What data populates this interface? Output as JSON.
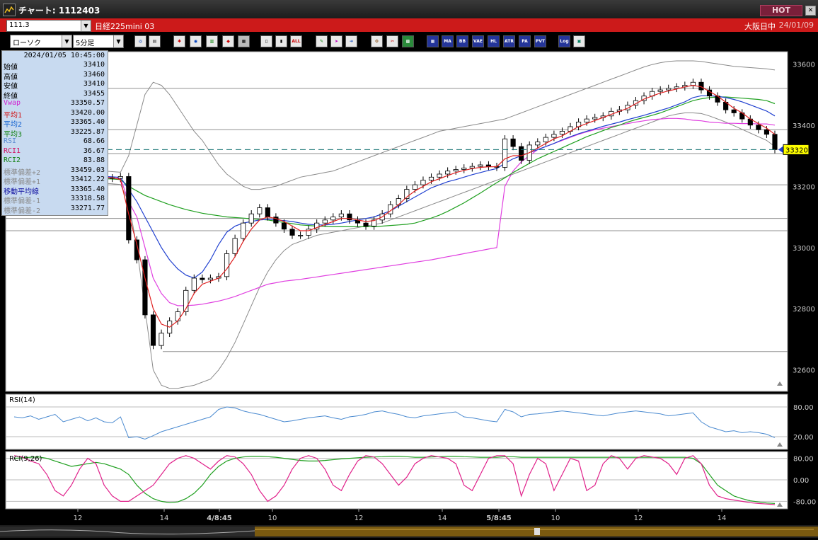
{
  "window": {
    "title": "チャート: 1112403",
    "hot_label": "HOT"
  },
  "header": {
    "code": "111.3",
    "instrument": "日経225mini 03",
    "market": "大阪日中",
    "date": "24/01/09"
  },
  "toolbar": {
    "chart_type": "ローソク",
    "timeframe": "5分足",
    "buttons": [
      "MA",
      "BB",
      "VAE",
      "HL",
      "ATR",
      "PA",
      "PVT",
      "Log"
    ]
  },
  "info_panel": {
    "datetime": "2024/01/05  10:45:00",
    "rows": [
      {
        "label": "始値",
        "value": "33410",
        "color": "#000000"
      },
      {
        "label": "高値",
        "value": "33460",
        "color": "#000000"
      },
      {
        "label": "安値",
        "value": "33410",
        "color": "#000000"
      },
      {
        "label": "終値",
        "value": "33455",
        "color": "#000000"
      },
      {
        "label": "Vwap",
        "value": "33350.57",
        "color": "#d020d0"
      },
      {
        "label": "平均1",
        "value": "33420.00",
        "color": "#d01010"
      },
      {
        "label": "平均2",
        "value": "33365.40",
        "color": "#1060d0"
      },
      {
        "label": "平均3",
        "value": "33225.87",
        "color": "#108010"
      },
      {
        "label": "RSI",
        "value": "68.66",
        "color": "#5a8ad0"
      },
      {
        "label": "RCI1",
        "value": "36.67",
        "color": "#d01060"
      },
      {
        "label": "RCI2",
        "value": "83.88",
        "color": "#108010"
      },
      {
        "label": "標準偏差+2",
        "value": "33459.03",
        "color": "#8a8a8a"
      },
      {
        "label": "標準偏差+1",
        "value": "33412.22",
        "color": "#8a8a8a"
      },
      {
        "label": "移動平均線",
        "value": "33365.40",
        "color": "#1010a0"
      },
      {
        "label": "標準偏差-1",
        "value": "33318.58",
        "color": "#8a8a8a"
      },
      {
        "label": "標準偏差-2",
        "value": "33271.77",
        "color": "#8a8a8a"
      }
    ]
  },
  "price_badge": "33320",
  "colors": {
    "ma_short": "#e02020",
    "ma_mid": "#2040d0",
    "ma_long": "#20a020",
    "vwap": "#e040e0",
    "bands": "#8a8a8a",
    "rsi": "#4a8ad0",
    "rci_short": "#e0208a",
    "rci_long": "#20a020"
  },
  "chart_data": {
    "type": "candlestick",
    "y_range": [
      32530,
      33640
    ],
    "y_ticks": [
      "33600",
      "33400",
      "33200",
      "33000",
      "32800",
      "32600"
    ],
    "x_ticks": [
      "12",
      "14",
      "4/8:45",
      "10",
      "12",
      "14",
      "5/8:45",
      "10",
      "12",
      "14"
    ],
    "last_price": 33320,
    "close": [
      33225,
      33228,
      33232,
      33238,
      33240,
      33242,
      33240,
      33238,
      33236,
      33232,
      33230,
      33228,
      33226,
      33232,
      33025,
      32960,
      32780,
      32680,
      32720,
      32760,
      32790,
      32860,
      32900,
      32895,
      32900,
      32905,
      32980,
      33030,
      33080,
      33110,
      33130,
      33100,
      33080,
      33060,
      33040,
      33040,
      33060,
      33080,
      33090,
      33100,
      33110,
      33090,
      33080,
      33070,
      33090,
      33110,
      33140,
      33160,
      33190,
      33205,
      33220,
      33230,
      33240,
      33250,
      33255,
      33260,
      33265,
      33270,
      33265,
      33262,
      33355,
      33330,
      33285,
      33335,
      33345,
      33360,
      33370,
      33380,
      33395,
      33410,
      33420,
      33425,
      33430,
      33445,
      33450,
      33465,
      33480,
      33495,
      33510,
      33515,
      33520,
      33525,
      33530,
      33540,
      33515,
      33495,
      33475,
      33450,
      33440,
      33420,
      33400,
      33385,
      33370,
      33320
    ],
    "ma_short": [
      33228,
      33230,
      33233,
      33236,
      33238,
      33239,
      33239,
      33238,
      33236,
      33234,
      33232,
      33230,
      33228,
      33222,
      33110,
      33010,
      32900,
      32800,
      32750,
      32740,
      32760,
      32800,
      32850,
      32880,
      32890,
      32900,
      32930,
      32970,
      33020,
      33060,
      33090,
      33100,
      33095,
      33085,
      33070,
      33055,
      33055,
      33065,
      33075,
      33085,
      33095,
      33095,
      33090,
      33085,
      33088,
      33100,
      33120,
      33140,
      33165,
      33185,
      33200,
      33215,
      33225,
      33235,
      33245,
      33252,
      33258,
      33262,
      33264,
      33264,
      33290,
      33300,
      33300,
      33310,
      33325,
      33340,
      33355,
      33365,
      33380,
      33395,
      33405,
      33415,
      33425,
      33435,
      33445,
      33455,
      33470,
      33485,
      33495,
      33505,
      33512,
      33518,
      33525,
      33530,
      33525,
      33510,
      33495,
      33475,
      33455,
      33440,
      33420,
      33405,
      33390,
      33370
    ],
    "ma_mid": [
      33230,
      33231,
      33232,
      33233,
      33234,
      33235,
      33235,
      33235,
      33235,
      33234,
      33233,
      33232,
      33231,
      33229,
      33190,
      33150,
      33100,
      33050,
      33000,
      32960,
      32930,
      32910,
      32900,
      32920,
      32960,
      33010,
      33050,
      33070,
      33080,
      33085,
      33090,
      33092,
      33090,
      33088,
      33085,
      33080,
      33076,
      33074,
      33074,
      33076,
      33080,
      33085,
      33090,
      33095,
      33100,
      33110,
      33120,
      33135,
      33150,
      33165,
      33180,
      33195,
      33205,
      33215,
      33222,
      33230,
      33238,
      33245,
      33252,
      33258,
      33275,
      33290,
      33300,
      33310,
      33320,
      33330,
      33340,
      33352,
      33362,
      33372,
      33380,
      33388,
      33396,
      33403,
      33410,
      33418,
      33425,
      33432,
      33440,
      33448,
      33456,
      33466,
      33476,
      33490,
      33496,
      33496,
      33494,
      33490,
      33484,
      33476,
      33466,
      33456,
      33446,
      33430
    ],
    "ma_long": [
      33244,
      33242,
      33240,
      33238,
      33236,
      33234,
      33232,
      33230,
      33228,
      33227,
      33226,
      33225,
      33224,
      33222,
      33200,
      33185,
      33170,
      33160,
      33150,
      33140,
      33132,
      33124,
      33118,
      33112,
      33108,
      33104,
      33100,
      33098,
      33096,
      33094,
      33092,
      33090,
      33086,
      33082,
      33078,
      33074,
      33072,
      33070,
      33069,
      33068,
      33068,
      33068,
      33068,
      33068,
      33068,
      33070,
      33072,
      33074,
      33076,
      33080,
      33088,
      33096,
      33106,
      33118,
      33132,
      33146,
      33162,
      33178,
      33195,
      33212,
      33228,
      33245,
      33260,
      33275,
      33290,
      33302,
      33314,
      33326,
      33338,
      33350,
      33362,
      33372,
      33382,
      33392,
      33400,
      33410,
      33418,
      33425,
      33432,
      33440,
      33450,
      33460,
      33470,
      33480,
      33486,
      33490,
      33492,
      33492,
      33490,
      33488,
      33486,
      33484,
      33480,
      33470
    ],
    "vwap": [
      33220,
      33221,
      33222,
      33223,
      33224,
      33225,
      33225,
      33226,
      33226,
      33226,
      33226,
      33226,
      33226,
      33226,
      33150,
      33100,
      33000,
      32900,
      32850,
      32820,
      32810,
      32810,
      32812,
      32815,
      32820,
      32825,
      32832,
      32840,
      32850,
      32860,
      32870,
      32880,
      32885,
      32890,
      32893,
      32896,
      32900,
      32904,
      32908,
      32912,
      32916,
      32920,
      32924,
      32928,
      32932,
      32936,
      32940,
      32944,
      32948,
      32952,
      32956,
      32960,
      32965,
      32970,
      32975,
      32980,
      32985,
      32990,
      32995,
      33000,
      33200,
      33250,
      33280,
      33300,
      33320,
      33330,
      33340,
      33350,
      33360,
      33370,
      33378,
      33385,
      33390,
      33395,
      33400,
      33405,
      33410,
      33414,
      33418,
      33420,
      33422,
      33422,
      33420,
      33416,
      33414,
      33410,
      33408,
      33406,
      33406,
      33405,
      33405,
      33404,
      33404,
      33400
    ],
    "band_upper": [
      33250,
      33252,
      33254,
      33256,
      33258,
      33258,
      33258,
      33258,
      33256,
      33254,
      33252,
      33250,
      33248,
      33246,
      33300,
      33400,
      33500,
      33540,
      33530,
      33500,
      33460,
      33420,
      33380,
      33350,
      33310,
      33270,
      33240,
      33220,
      33200,
      33190,
      33190,
      33195,
      33200,
      33210,
      33220,
      33230,
      33235,
      33240,
      33245,
      33250,
      33260,
      33270,
      33280,
      33290,
      33300,
      33310,
      33320,
      33330,
      33340,
      33350,
      33360,
      33370,
      33380,
      33385,
      33390,
      33395,
      33400,
      33405,
      33410,
      33415,
      33420,
      33430,
      33440,
      33450,
      33460,
      33470,
      33480,
      33490,
      33500,
      33510,
      33520,
      33530,
      33540,
      33550,
      33560,
      33570,
      33580,
      33590,
      33598,
      33604,
      33608,
      33610,
      33610,
      33610,
      33608,
      33604,
      33600,
      33596,
      33592,
      33590,
      33588,
      33586,
      33584,
      33580
    ],
    "band_lower": [
      33210,
      33212,
      33214,
      33216,
      33218,
      33220,
      33220,
      33218,
      33216,
      33214,
      33212,
      33210,
      33208,
      33206,
      33150,
      33000,
      32800,
      32600,
      32550,
      32540,
      32540,
      32545,
      32550,
      32560,
      32570,
      32600,
      32640,
      32690,
      32750,
      32810,
      32870,
      32920,
      32960,
      32990,
      33010,
      33020,
      33030,
      33040,
      33045,
      33050,
      33055,
      33060,
      33065,
      33070,
      33075,
      33080,
      33090,
      33100,
      33110,
      33120,
      33130,
      33140,
      33150,
      33160,
      33170,
      33180,
      33190,
      33200,
      33210,
      33220,
      33230,
      33240,
      33250,
      33260,
      33270,
      33280,
      33290,
      33300,
      33310,
      33320,
      33330,
      33340,
      33350,
      33360,
      33370,
      33380,
      33390,
      33400,
      33410,
      33420,
      33430,
      33436,
      33440,
      33440,
      33438,
      33430,
      33420,
      33410,
      33398,
      33386,
      33374,
      33362,
      33350,
      33330
    ],
    "rsi_range": [
      0,
      100
    ],
    "rsi_ticks": [
      "80.00",
      "20.00"
    ],
    "rsi": [
      60,
      58,
      62,
      55,
      60,
      65,
      50,
      55,
      60,
      52,
      58,
      50,
      48,
      60,
      18,
      20,
      15,
      22,
      30,
      35,
      40,
      45,
      50,
      55,
      60,
      75,
      80,
      78,
      72,
      68,
      65,
      60,
      55,
      50,
      52,
      55,
      58,
      60,
      62,
      58,
      55,
      60,
      62,
      65,
      70,
      72,
      68,
      65,
      60,
      58,
      62,
      64,
      66,
      68,
      70,
      60,
      58,
      55,
      52,
      50,
      75,
      70,
      60,
      65,
      66,
      68,
      70,
      72,
      70,
      68,
      66,
      64,
      62,
      65,
      68,
      70,
      72,
      70,
      68,
      66,
      62,
      64,
      66,
      68,
      50,
      40,
      35,
      30,
      32,
      28,
      30,
      28,
      25,
      18
    ],
    "rci_range": [
      -100,
      100
    ],
    "rci_ticks": [
      "80.00",
      "0.00",
      "-80.00"
    ],
    "rci_short": [
      90,
      85,
      70,
      60,
      20,
      -40,
      -60,
      -20,
      40,
      80,
      60,
      -20,
      -60,
      -80,
      -80,
      -60,
      -40,
      -20,
      20,
      60,
      80,
      90,
      80,
      60,
      40,
      70,
      90,
      85,
      60,
      20,
      -40,
      -80,
      -60,
      -20,
      40,
      80,
      90,
      80,
      40,
      -20,
      -40,
      20,
      70,
      90,
      85,
      60,
      20,
      -20,
      10,
      60,
      80,
      90,
      85,
      80,
      60,
      -20,
      -40,
      20,
      80,
      90,
      90,
      60,
      -60,
      20,
      80,
      60,
      -40,
      20,
      80,
      70,
      -40,
      -20,
      60,
      90,
      80,
      40,
      80,
      90,
      85,
      80,
      60,
      20,
      80,
      90,
      60,
      -20,
      -60,
      -70,
      -75,
      -80,
      -85,
      -88,
      -90,
      -92
    ],
    "rci_long": [
      80,
      82,
      84,
      85,
      80,
      70,
      60,
      50,
      55,
      60,
      65,
      60,
      50,
      40,
      20,
      -20,
      -50,
      -70,
      -80,
      -85,
      -82,
      -70,
      -50,
      -20,
      20,
      50,
      70,
      80,
      85,
      88,
      88,
      86,
      84,
      80,
      76,
      72,
      70,
      70,
      72,
      75,
      78,
      80,
      82,
      84,
      85,
      86,
      88,
      88,
      86,
      84,
      84,
      85,
      86,
      88,
      88,
      86,
      85,
      84,
      84,
      84,
      86,
      86,
      84,
      84,
      84,
      84,
      84,
      84,
      84,
      84,
      84,
      84,
      84,
      84,
      84,
      84,
      84,
      84,
      84,
      84,
      84,
      84,
      84,
      80,
      60,
      20,
      -20,
      -40,
      -60,
      -70,
      -78,
      -82,
      -86,
      -88
    ]
  }
}
